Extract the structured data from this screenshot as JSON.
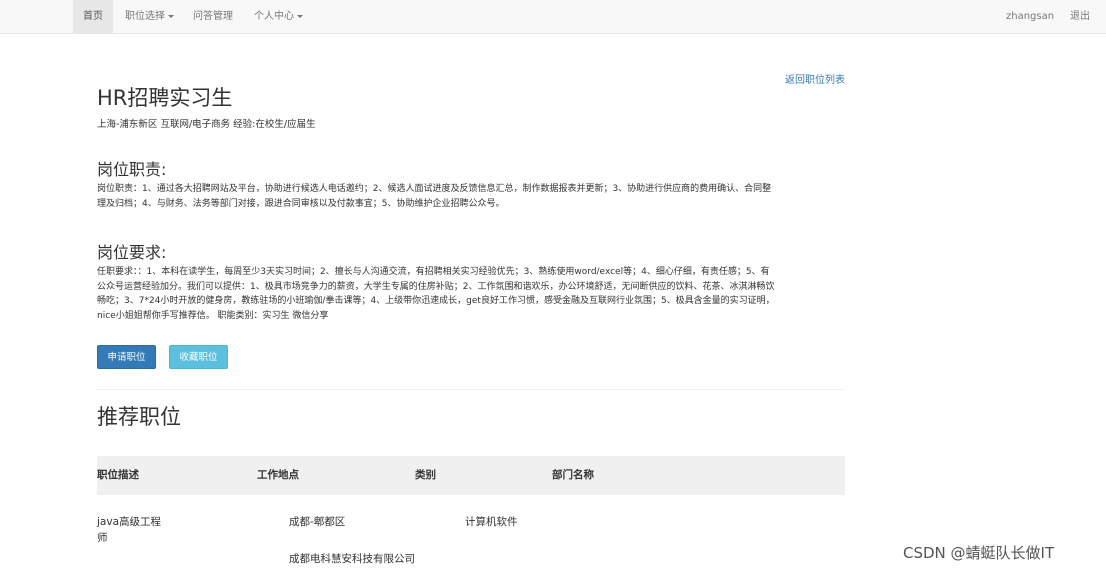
{
  "nav": {
    "home": "首页",
    "job_select": "职位选择",
    "qa_manage": "问答管理",
    "personal_center": "个人中心",
    "username": "zhangsan",
    "logout": "退出"
  },
  "job": {
    "back_link": "返回职位列表",
    "title": "HR招聘实习生",
    "meta": "上海-浦东新区 互联网/电子商务 经验:在校生/应届生",
    "duty_heading": "岗位职责:",
    "duty_lines": [
      "岗位职责：1、通过各大招聘网站及平台，协助进行候选人电话邀约；2、候选人面试进度及反馈信息汇总，制作数据报表并更新；3、协助进行供应商的费用确认、合同整",
      "理及归档；4、与财务、法务等部门对接，跟进合同审核以及付款事宜；5、协助维护企业招聘公众号。"
    ],
    "req_heading": "岗位要求:",
    "req_lines": [
      "任职要求：：1、本科在读学生，每周至少3天实习时间；2、擅长与人沟通交流，有招聘相关实习经验优先；3、熟练使用word/excel等；4、细心仔细，有责任感；5、有",
      "公众号运营经验加分。我们可以提供：1、极具市场竞争力的薪资，大学生专属的住房补贴；2、工作氛围和谐欢乐，办公环境舒适，无间断供应的饮料、花茶、冰淇淋畅饮",
      "畅吃；3、7*24小时开放的健身房，教练驻场的小班瑜伽/拳击课等；4、上级带你迅速成长，get良好工作习惯，感受金融及互联网行业氛围；5、极具含金量的实习证明，",
      "nice小姐姐帮你手写推荐信。 职能类别：实习生 微信分享"
    ],
    "apply_button": "申请职位",
    "favorite_button": "收藏职位"
  },
  "recommend": {
    "heading": "推荐职位",
    "columns": [
      "职位描述",
      "工作地点",
      "类别",
      "部门名称"
    ],
    "rows": [
      {
        "desc_line1": "java高级工程",
        "desc_line2": "师",
        "location": "成都-郫都区",
        "category": "计算机软件",
        "department": "成都电科慧安科技有限公司"
      }
    ]
  },
  "watermark": "CSDN @蜻蜓队长做IT"
}
